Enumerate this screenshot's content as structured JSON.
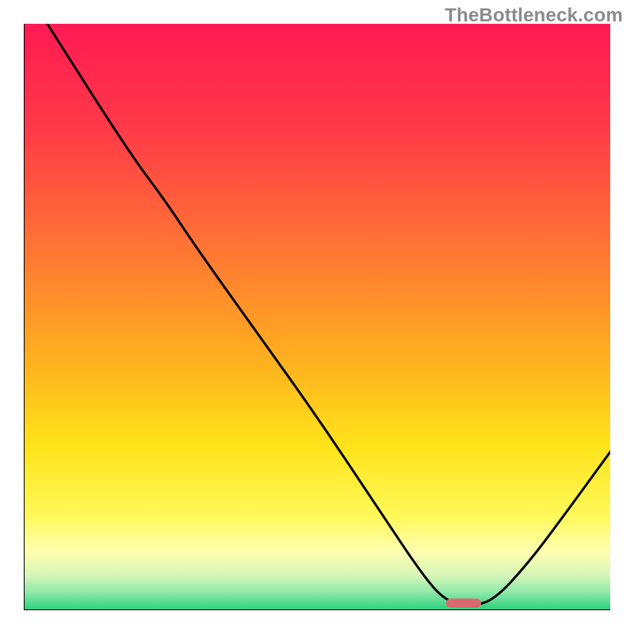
{
  "watermark": "TheBottleneck.com",
  "chart_data": {
    "type": "line",
    "title": "",
    "xlabel": "",
    "ylabel": "",
    "x_range": [
      0,
      100
    ],
    "y_range": [
      0,
      100
    ],
    "grid": false,
    "legend": false,
    "gradient_stops": [
      {
        "offset": 0,
        "color": "#ff1a53"
      },
      {
        "offset": 18,
        "color": "#ff3a48"
      },
      {
        "offset": 40,
        "color": "#ff7a32"
      },
      {
        "offset": 58,
        "color": "#ffb21e"
      },
      {
        "offset": 72,
        "color": "#ffe31a"
      },
      {
        "offset": 84,
        "color": "#fff95a"
      },
      {
        "offset": 90,
        "color": "#ffffb0"
      },
      {
        "offset": 94,
        "color": "#d6f6b8"
      },
      {
        "offset": 97,
        "color": "#8de8a8"
      },
      {
        "offset": 100,
        "color": "#28d17c"
      }
    ],
    "series": [
      {
        "name": "curve",
        "points": [
          {
            "x": 4,
            "y": 100
          },
          {
            "x": 18,
            "y": 78
          },
          {
            "x": 24,
            "y": 70
          },
          {
            "x": 30,
            "y": 61
          },
          {
            "x": 40,
            "y": 47
          },
          {
            "x": 50,
            "y": 33
          },
          {
            "x": 60,
            "y": 18
          },
          {
            "x": 68,
            "y": 6
          },
          {
            "x": 72,
            "y": 1.5
          },
          {
            "x": 76,
            "y": 0.8
          },
          {
            "x": 80,
            "y": 1.5
          },
          {
            "x": 86,
            "y": 8
          },
          {
            "x": 92,
            "y": 16
          },
          {
            "x": 100,
            "y": 27
          }
        ]
      }
    ],
    "marker": {
      "name": "highlight-pill",
      "x": 75,
      "y": 1.2,
      "width": 6,
      "height": 1.6,
      "color": "#d96a6f"
    }
  }
}
